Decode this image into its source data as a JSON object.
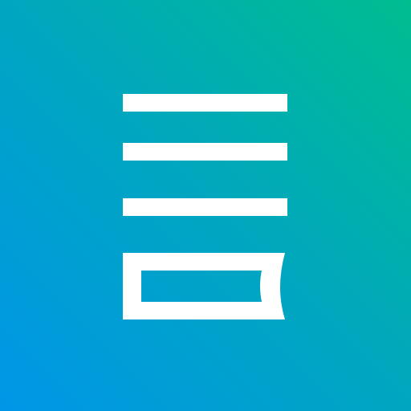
{
  "app_icon": {
    "icon": "note-list-icon",
    "colors": {
      "gradient_start": "#0096E8",
      "gradient_mid": "#00A6C0",
      "gradient_end": "#00BD90",
      "glyph": "#FFFFFF"
    }
  }
}
